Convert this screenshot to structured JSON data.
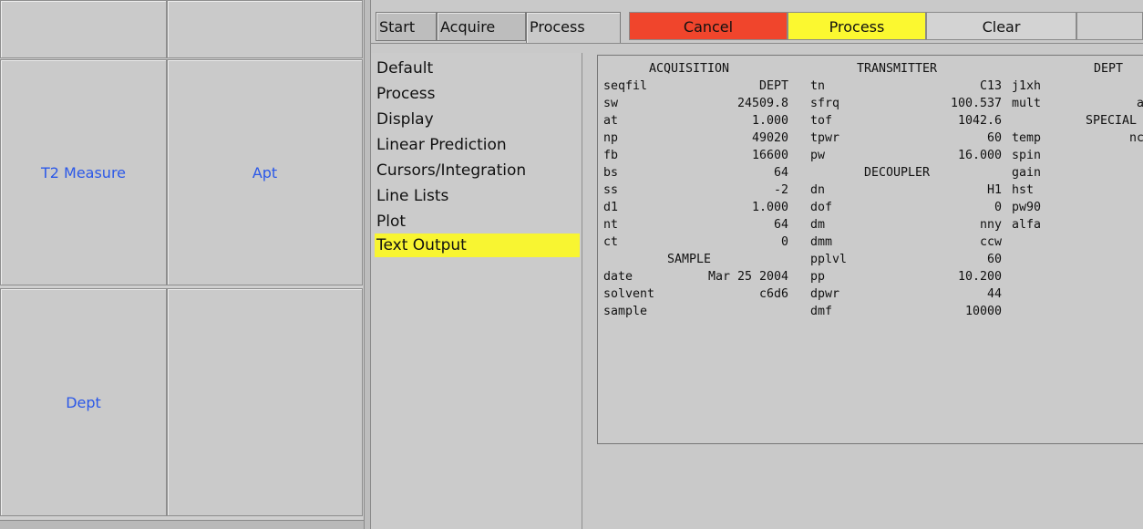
{
  "experiments": {
    "top_left": "",
    "top_right": "",
    "mid_left": "T2 Measure",
    "mid_right": "Apt",
    "bottom_left": "Dept",
    "bottom_right": ""
  },
  "tabs": [
    "Start",
    "Acquire",
    "Process"
  ],
  "buttons": {
    "cancel": "Cancel",
    "process": "Process",
    "clear": "Clear",
    "cancel_color": "#f0452c",
    "process_color": "#fbf830"
  },
  "process_menu": {
    "items": [
      "Default",
      "Process",
      "Display",
      "Linear Prediction",
      "Cursors/Integration",
      "Line Lists",
      "Plot",
      "Text Output"
    ],
    "selected": "Text Output",
    "selected_color": "#f8f531"
  },
  "params": {
    "acquisition": {
      "header": "ACQUISITION",
      "rows": [
        [
          "seqfil",
          "DEPT"
        ],
        [
          "sw",
          "24509.8"
        ],
        [
          "at",
          "1.000"
        ],
        [
          "np",
          "49020"
        ],
        [
          "fb",
          "16600"
        ],
        [
          "bs",
          "64"
        ],
        [
          "ss",
          "-2"
        ],
        [
          "d1",
          "1.000"
        ],
        [
          "nt",
          "64"
        ],
        [
          "ct",
          "0"
        ]
      ]
    },
    "sample": {
      "header": "SAMPLE",
      "rows": [
        [
          "date",
          "Mar 25 2004"
        ],
        [
          "solvent",
          "c6d6"
        ],
        [
          "sample",
          ""
        ]
      ]
    },
    "transmitter": {
      "header": "TRANSMITTER",
      "rows": [
        [
          "tn",
          "C13"
        ],
        [
          "sfrq",
          "100.537"
        ],
        [
          "tof",
          "1042.6"
        ],
        [
          "tpwr",
          "60"
        ],
        [
          "pw",
          "16.000"
        ]
      ]
    },
    "decoupler": {
      "header": "DECOUPLER",
      "rows": [
        [
          "dn",
          "H1"
        ],
        [
          "dof",
          "0"
        ],
        [
          "dm",
          "nny"
        ],
        [
          "dmm",
          "ccw"
        ],
        [
          "pplvl",
          "60"
        ],
        [
          "pp",
          "10.200"
        ],
        [
          "dpwr",
          "44"
        ],
        [
          "dmf",
          "10000"
        ]
      ]
    },
    "dept": {
      "header": "DEPT",
      "rows": [
        [
          "j1xh",
          ""
        ],
        [
          "mult",
          "a"
        ]
      ]
    },
    "special": {
      "header": "SPECIAL",
      "rows": [
        [
          "temp",
          "nc"
        ],
        [
          "spin",
          ""
        ],
        [
          "gain",
          ""
        ],
        [
          "hst",
          ""
        ],
        [
          "pw90",
          ""
        ],
        [
          "alfa",
          ""
        ]
      ]
    }
  }
}
